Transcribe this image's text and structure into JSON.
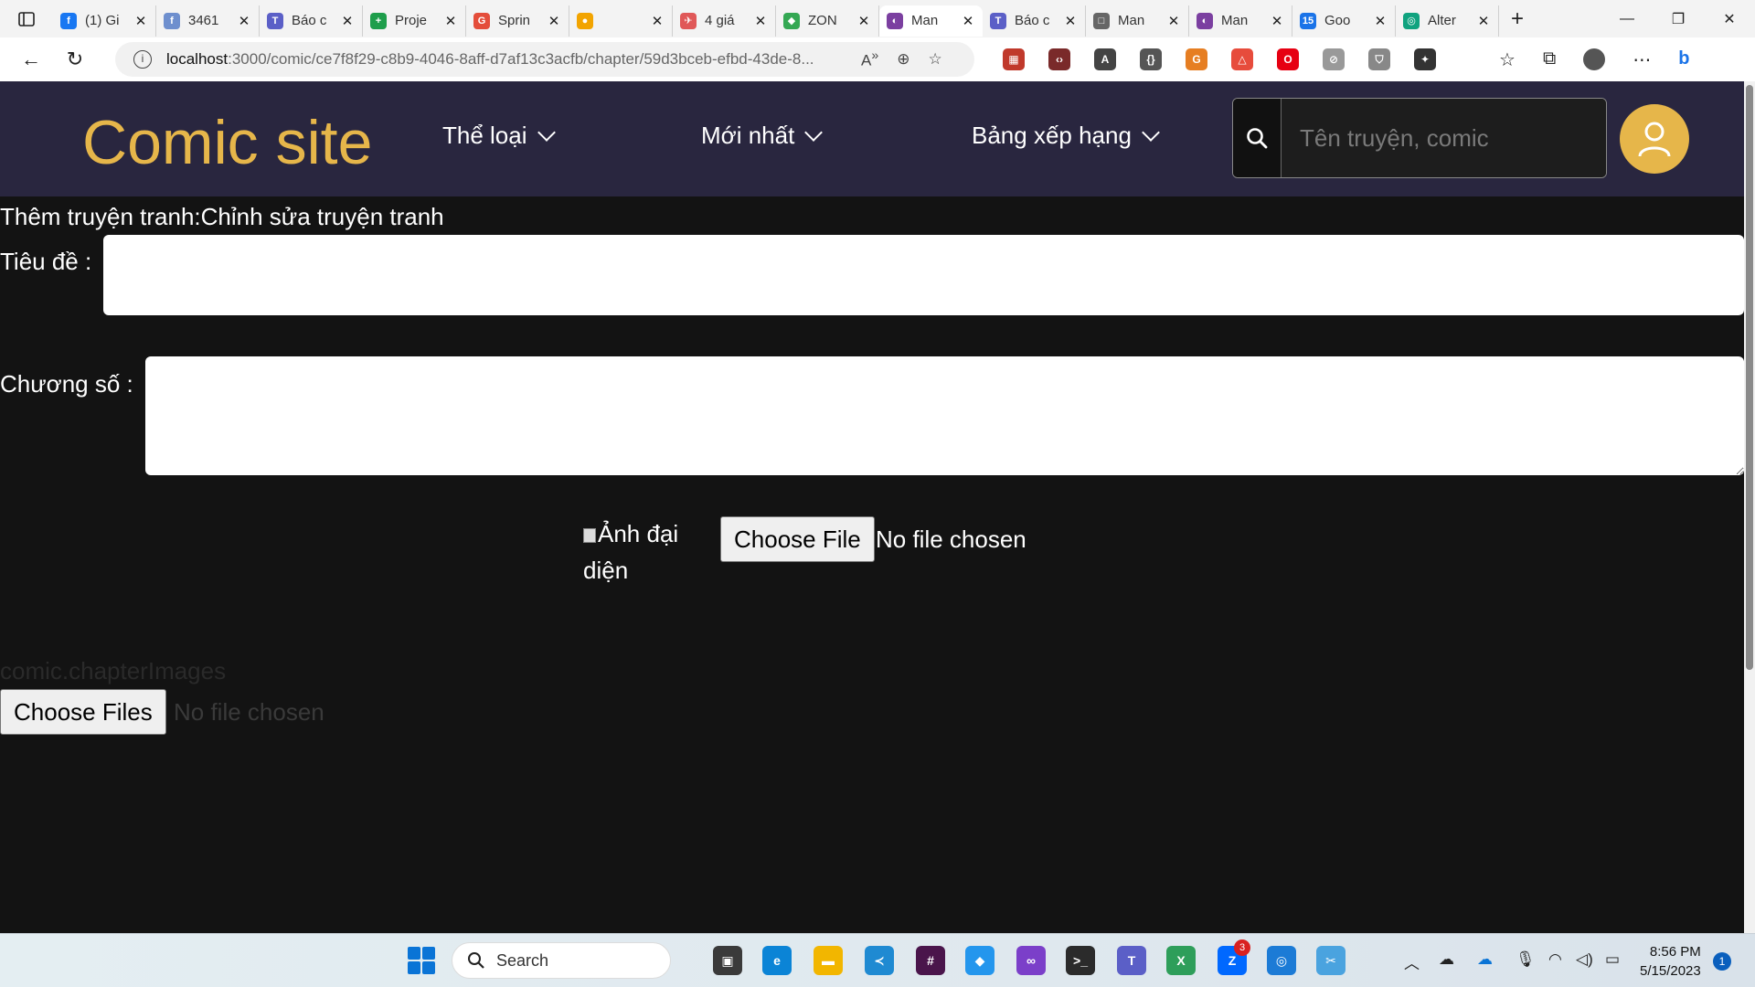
{
  "browser": {
    "tabs": [
      {
        "label": "(1) Gi",
        "fav_color": "#1877f2",
        "fav_glyph": "f"
      },
      {
        "label": "3461",
        "fav_color": "#6e8fce",
        "fav_glyph": "f"
      },
      {
        "label": "Báo c",
        "fav_color": "#5b5fc7",
        "fav_glyph": "T"
      },
      {
        "label": "Proje",
        "fav_color": "#1e9e4b",
        "fav_glyph": "+"
      },
      {
        "label": "Sprin",
        "fav_color": "#e44d3a",
        "fav_glyph": "G"
      },
      {
        "label": "",
        "fav_color": "#f2a400",
        "fav_glyph": "●"
      },
      {
        "label": "4 giá",
        "fav_color": "#e05858",
        "fav_glyph": "✈"
      },
      {
        "label": "ZON",
        "fav_color": "#34a853",
        "fav_glyph": "◆"
      },
      {
        "label": "Man",
        "fav_color": "#7b3fa0",
        "fav_glyph": "◐"
      },
      {
        "label": "Báo c",
        "fav_color": "#5b5fc7",
        "fav_glyph": "T"
      },
      {
        "label": "Man",
        "fav_color": "#666666",
        "fav_glyph": "□"
      },
      {
        "label": "Man",
        "fav_color": "#7b3fa0",
        "fav_glyph": "◐"
      },
      {
        "label": "Goo",
        "fav_color": "#1a73e8",
        "fav_glyph": "15"
      },
      {
        "label": "Alter",
        "fav_color": "#10a37f",
        "fav_glyph": "◎"
      }
    ],
    "active_tab_index": 8,
    "url_host": "localhost",
    "url_path": ":3000/comic/ce7f8f29-c8b9-4046-8aff-d7af13c3acfb/chapter/59d3bceb-efbd-43de-8...",
    "info_glyph": "i",
    "extensions": [
      {
        "color": "#c0392b",
        "glyph": "▦"
      },
      {
        "color": "#7a2a2a",
        "glyph": "‹›"
      },
      {
        "color": "#444444",
        "glyph": "A"
      },
      {
        "color": "#555555",
        "glyph": "{}"
      },
      {
        "color": "#e67e22",
        "glyph": "G"
      },
      {
        "color": "#e74c3c",
        "glyph": "△"
      },
      {
        "color": "#e60012",
        "glyph": "O"
      },
      {
        "color": "#999999",
        "glyph": "⊘"
      },
      {
        "color": "#888888",
        "glyph": "⛉"
      },
      {
        "color": "#333333",
        "glyph": "✦"
      }
    ]
  },
  "site": {
    "logo": "Comic site",
    "menu": [
      {
        "label": "Thể loại"
      },
      {
        "label": "Mới nhất"
      },
      {
        "label": "Bảng xếp hạng"
      }
    ],
    "search_placeholder": "Tên truyện, comic",
    "colors": {
      "header_bg": "#29263f",
      "logo": "#e6b64a",
      "page_bg": "#131313"
    }
  },
  "form": {
    "title": "Thêm truyện tranh:Chỉnh sửa truyện tranh",
    "title_label": "Tiêu đề :",
    "title_value": "",
    "chapter_label": "Chương số :",
    "chapter_value": "",
    "avatar_alt": "Ảnh đại diện",
    "avatar_button": "Choose File",
    "avatar_status": "No file chosen",
    "chapter_images_label": "comic.chapterImages",
    "images_button": "Choose Files",
    "images_status": "No file chosen"
  },
  "taskbar": {
    "search_label": "Search",
    "apps": [
      {
        "name": "task-view",
        "color": "#3a3a3a",
        "glyph": "▣"
      },
      {
        "name": "edge",
        "color": "#0b84d6",
        "glyph": "e"
      },
      {
        "name": "file-explorer",
        "color": "#f2b600",
        "glyph": "▬"
      },
      {
        "name": "vscode",
        "color": "#1f8ad2",
        "glyph": "≺"
      },
      {
        "name": "slack",
        "color": "#4a154b",
        "glyph": "#"
      },
      {
        "name": "docker",
        "color": "#2496ed",
        "glyph": "◆"
      },
      {
        "name": "visual-studio",
        "color": "#7b3fc9",
        "glyph": "∞"
      },
      {
        "name": "terminal",
        "color": "#2b2b2b",
        "glyph": ">_"
      },
      {
        "name": "teams",
        "color": "#5b5fc7",
        "glyph": "T"
      },
      {
        "name": "excel-tool",
        "color": "#2e9e5a",
        "glyph": "X"
      },
      {
        "name": "zalo",
        "color": "#0068ff",
        "glyph": "Z"
      },
      {
        "name": "browser-active",
        "color": "#1c7bd6",
        "glyph": "◎"
      },
      {
        "name": "snipping-tool",
        "color": "#4aa3df",
        "glyph": "✂"
      }
    ],
    "zalo_badge": "3",
    "time": "8:56 PM",
    "date": "5/15/2023",
    "notification_count": "1"
  }
}
